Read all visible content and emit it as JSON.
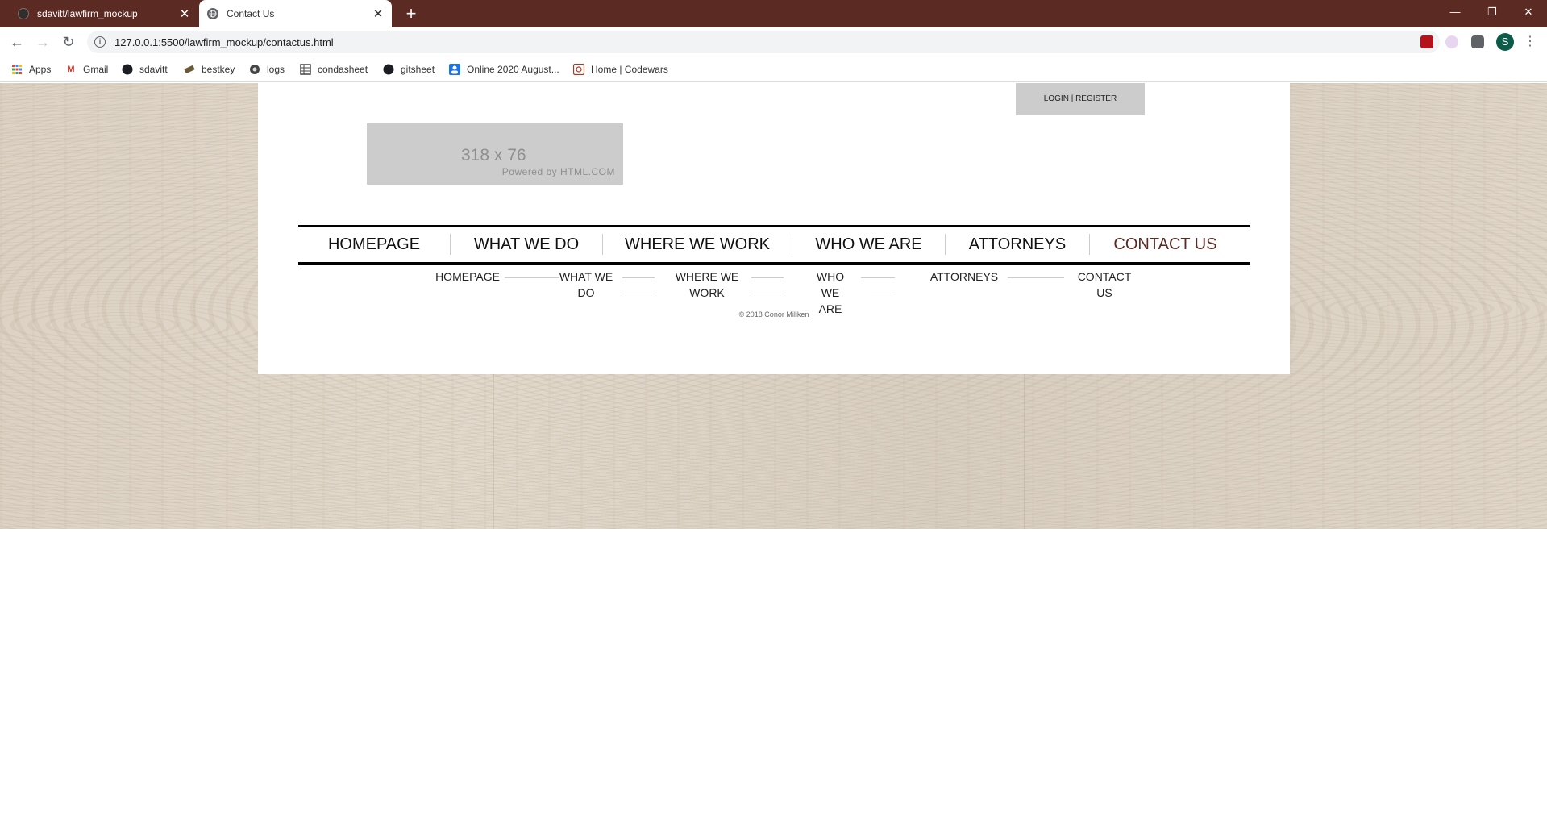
{
  "browser": {
    "tabs": [
      {
        "title": "sdavitt/lawfirm_mockup",
        "active": false
      },
      {
        "title": "Contact Us",
        "active": true
      }
    ],
    "url": "127.0.0.1:5500/lawfirm_mockup/contactus.html",
    "profile_initial": "S",
    "bookmarks": [
      {
        "label": "Apps",
        "icon": "apps-grid-icon"
      },
      {
        "label": "Gmail",
        "icon": "gmail-icon"
      },
      {
        "label": "sdavitt",
        "icon": "github-icon"
      },
      {
        "label": "bestkey",
        "icon": "bestkey-icon"
      },
      {
        "label": "logs",
        "icon": "logs-icon"
      },
      {
        "label": "condasheet",
        "icon": "sheet-icon"
      },
      {
        "label": "gitsheet",
        "icon": "github-icon"
      },
      {
        "label": "Online 2020 August...",
        "icon": "person-icon"
      },
      {
        "label": "Home | Codewars",
        "icon": "codewars-icon"
      }
    ],
    "colors": {
      "titlebar": "#5b2a22",
      "omnibox": "#f1f3f4"
    }
  },
  "page": {
    "login_label": "LOGIN | REGISTER",
    "logo_placeholder": {
      "dims": "318 x 76",
      "powered": "Powered by HTML.COM"
    },
    "main_nav": [
      {
        "label": "HOMEPAGE",
        "active": false
      },
      {
        "label": "WHAT WE DO",
        "active": false
      },
      {
        "label": "WHERE WE WORK",
        "active": false
      },
      {
        "label": "WHO WE ARE",
        "active": false
      },
      {
        "label": "ATTORNEYS",
        "active": false
      },
      {
        "label": "CONTACT US",
        "active": true
      }
    ],
    "footer_nav": [
      {
        "line1": "HOMEPAGE",
        "line2": ""
      },
      {
        "line1": "WHAT WE",
        "line2": "DO"
      },
      {
        "line1": "WHERE WE",
        "line2": "WORK"
      },
      {
        "line1": "WHO WE",
        "line2": "ARE"
      },
      {
        "line1": "ATTORNEYS",
        "line2": ""
      },
      {
        "line1": "CONTACT",
        "line2": "US"
      }
    ],
    "copyright": "© 2018 Conor Miliken",
    "colors": {
      "active_nav": "#5b2a22",
      "nav_rule": "#000000",
      "placeholder": "#cccccc"
    }
  }
}
